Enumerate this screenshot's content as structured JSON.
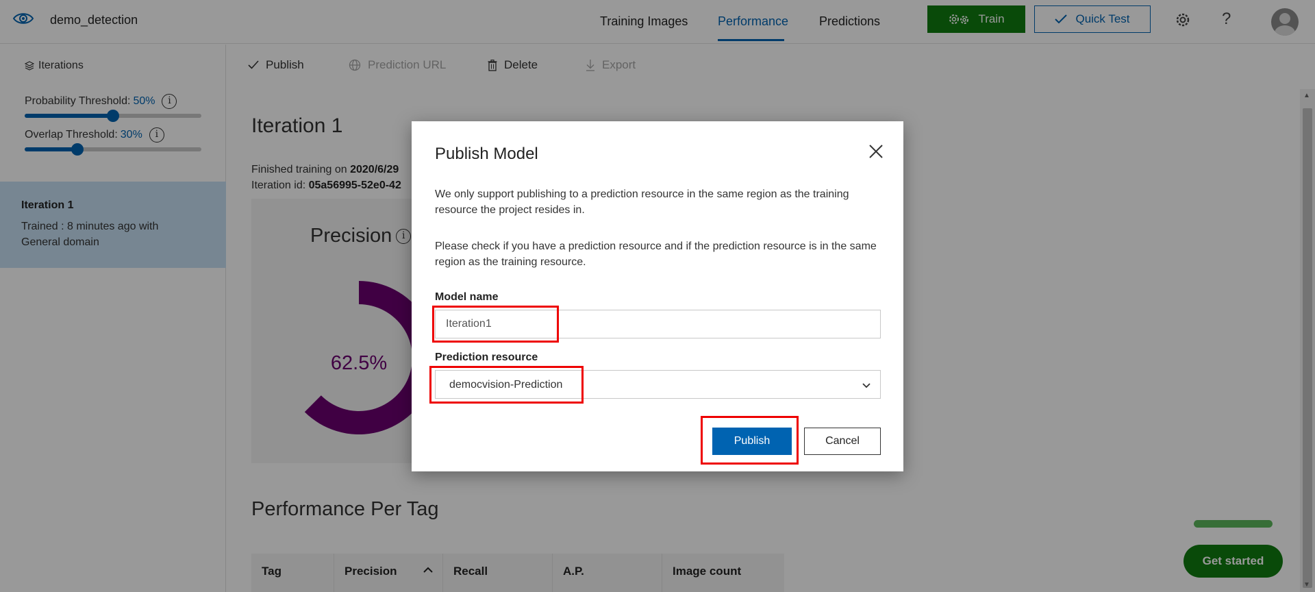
{
  "header": {
    "project_name": "demo_detection",
    "tabs": [
      {
        "label": "Training Images",
        "active": false
      },
      {
        "label": "Performance",
        "active": true
      },
      {
        "label": "Predictions",
        "active": false
      }
    ],
    "train_label": "Train",
    "quick_test_label": "Quick Test",
    "help_glyph": "?"
  },
  "sidebar": {
    "iterations_label": "Iterations",
    "probability_threshold": {
      "label": "Probability Threshold:",
      "value": "50%",
      "fraction": 0.5
    },
    "overlap_threshold": {
      "label": "Overlap Threshold:",
      "value": "30%",
      "fraction": 0.3
    },
    "iteration_card": {
      "title": "Iteration 1",
      "description": "Trained : 8 minutes ago with General domain"
    }
  },
  "toolbar": {
    "publish": "Publish",
    "prediction_url": "Prediction URL",
    "delete": "Delete",
    "export": "Export"
  },
  "main": {
    "iteration_title": "Iteration 1",
    "finished_prefix": "Finished training on ",
    "finished_date": "2020/6/29",
    "iteration_id_prefix": "Iteration id: ",
    "iteration_id": "05a56995-52e0-42",
    "precision_label": "Precision",
    "precision_value": "62.5%",
    "precision_fraction": 0.625,
    "perf_per_tag_title": "Performance Per Tag",
    "table_headers": [
      "Tag",
      "Precision",
      "Recall",
      "A.P.",
      "Image count"
    ]
  },
  "widgets": {
    "get_started_label": "Get started"
  },
  "modal": {
    "title": "Publish Model",
    "paragraph1": "We only support publishing to a prediction resource in the same region as the training resource the project resides in.",
    "paragraph2": "Please check if you have a prediction resource and if the prediction resource is in the same region as the training resource.",
    "model_name_label": "Model name",
    "model_name_value": "Iteration1",
    "prediction_resource_label": "Prediction resource",
    "prediction_resource_value": "democvision-Prediction",
    "publish_label": "Publish",
    "cancel_label": "Cancel"
  },
  "colors": {
    "accent": "#0063b1",
    "train_green": "#107c10",
    "precision_purple": "#6b0070",
    "highlight_red": "#e00000"
  }
}
